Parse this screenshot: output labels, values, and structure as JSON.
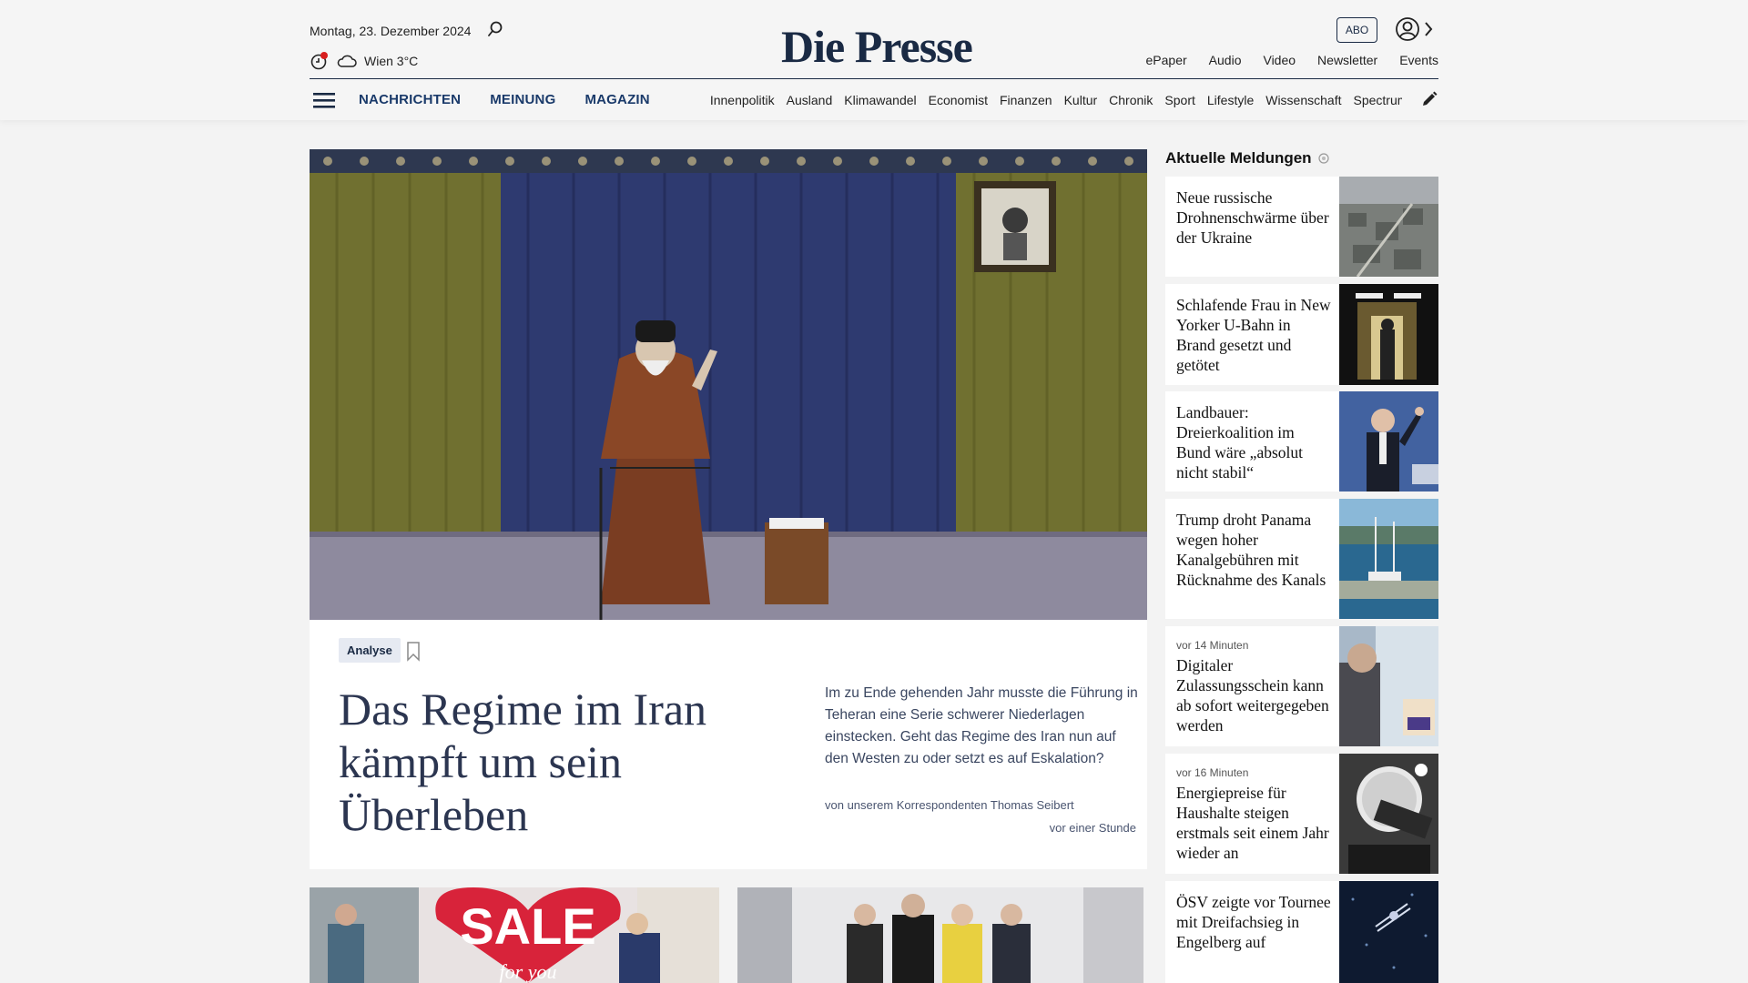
{
  "header": {
    "date": "Montag, 23. Dezember 2024",
    "weather": "Wien 3°C",
    "logo": "Die Presse",
    "abo_label": "ABO",
    "top_links": [
      "ePaper",
      "Audio",
      "Video",
      "Newsletter",
      "Events"
    ]
  },
  "nav": {
    "main": [
      "NACHRICHTEN",
      "MEINUNG",
      "MAGAZIN"
    ],
    "sections": [
      "Innenpolitik",
      "Ausland",
      "Klimawandel",
      "Economist",
      "Finanzen",
      "Kultur",
      "Chronik",
      "Sport",
      "Lifestyle",
      "Wissenschaft",
      "Spectrum"
    ]
  },
  "hero": {
    "badge": "Analyse",
    "headline": "Das Regime im Iran kämpft um sein Überleben",
    "teaser": "Im zu Ende gehenden Jahr musste die Führung in Teheran eine Serie schwerer Niederlagen einstecken. Geht das Regime des Iran nun auf den Westen zu oder setzt es auf Eskalation?",
    "byline": "von unserem Korrespondenten Thomas Seibert",
    "time": "vor einer Stunde"
  },
  "bottom": {
    "sale_text": "SALE",
    "sale_sub": "for you"
  },
  "sidebar": {
    "title": "Aktuelle Meldungen",
    "items": [
      {
        "meta": "",
        "title": "Neue russische Drohnenschwärme über der Ukraine"
      },
      {
        "meta": "",
        "title": "Schlafende Frau in New Yorker U-Bahn in Brand gesetzt und getötet"
      },
      {
        "meta": "",
        "title": "Landbauer: Dreierkoalition im Bund wäre „absolut nicht stabil“"
      },
      {
        "meta": "",
        "title": "Trump droht Panama wegen hoher Kanalgebühren mit Rücknahme des Kanals"
      },
      {
        "meta": "vor 14 Minuten",
        "title": "Digitaler Zulassungsschein kann ab sofort weitergegeben werden"
      },
      {
        "meta": "vor 16 Minuten",
        "title": "Energiepreise für Haushalte steigen erstmals seit einem Jahr wieder an"
      },
      {
        "meta": "",
        "title": "ÖSV zeigte vor Tournee mit Dreifachsieg in Engelberg auf"
      }
    ]
  }
}
